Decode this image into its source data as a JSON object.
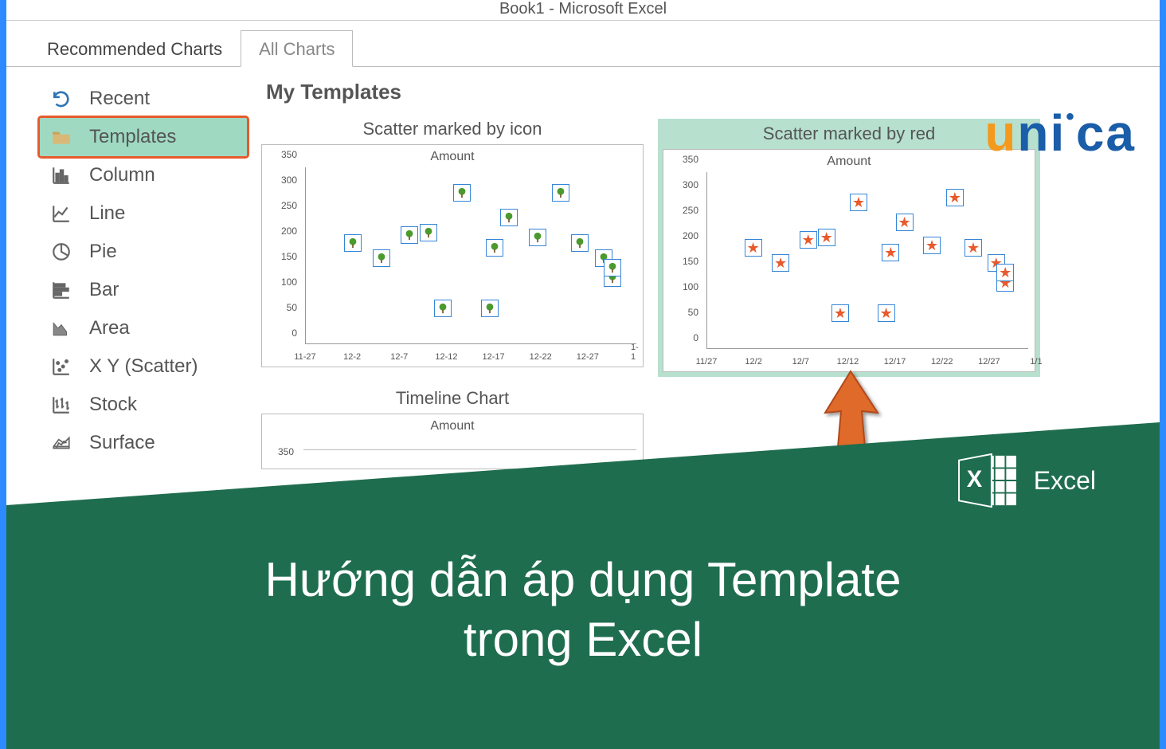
{
  "window_title": "Book1 - Microsoft Excel",
  "tabs": {
    "recommended": "Recommended Charts",
    "all": "All Charts"
  },
  "sidebar": {
    "items": [
      {
        "label": "Recent",
        "icon": "undo-icon"
      },
      {
        "label": "Templates",
        "icon": "folder-icon",
        "selected": true
      },
      {
        "label": "Column",
        "icon": "column-chart-icon"
      },
      {
        "label": "Line",
        "icon": "line-chart-icon"
      },
      {
        "label": "Pie",
        "icon": "pie-chart-icon"
      },
      {
        "label": "Bar",
        "icon": "bar-chart-icon"
      },
      {
        "label": "Area",
        "icon": "area-chart-icon"
      },
      {
        "label": "X Y (Scatter)",
        "icon": "scatter-chart-icon"
      },
      {
        "label": "Stock",
        "icon": "stock-chart-icon"
      },
      {
        "label": "Surface",
        "icon": "surface-chart-icon"
      }
    ]
  },
  "main": {
    "title": "My Templates",
    "charts": [
      {
        "title": "Scatter marked by icon",
        "inner_title": "Amount"
      },
      {
        "title": "Scatter marked by red",
        "inner_title": "Amount",
        "selected": true
      },
      {
        "title": "Timeline Chart",
        "inner_title": "Amount"
      }
    ]
  },
  "chart_data": [
    {
      "type": "scatter",
      "title": "Scatter marked by icon",
      "inner_title": "Amount",
      "xlabel": "",
      "ylabel": "",
      "ylim": [
        0,
        350
      ],
      "y_ticks": [
        0,
        50,
        100,
        150,
        200,
        250,
        300,
        350
      ],
      "x_ticks": [
        "11-27",
        "12-2",
        "12-7",
        "12-12",
        "12-17",
        "12-22",
        "12-27",
        "1-1"
      ],
      "marker": "green-tree-icon",
      "points": [
        {
          "xi": 1.0,
          "y": 200
        },
        {
          "xi": 1.6,
          "y": 170
        },
        {
          "xi": 2.2,
          "y": 215
        },
        {
          "xi": 2.6,
          "y": 220
        },
        {
          "xi": 2.9,
          "y": 70
        },
        {
          "xi": 3.3,
          "y": 300
        },
        {
          "xi": 3.9,
          "y": 70
        },
        {
          "xi": 4.0,
          "y": 190
        },
        {
          "xi": 4.3,
          "y": 250
        },
        {
          "xi": 4.9,
          "y": 210
        },
        {
          "xi": 5.4,
          "y": 300
        },
        {
          "xi": 5.8,
          "y": 200
        },
        {
          "xi": 6.3,
          "y": 170
        },
        {
          "xi": 6.5,
          "y": 130
        },
        {
          "xi": 6.5,
          "y": 150
        }
      ]
    },
    {
      "type": "scatter",
      "title": "Scatter marked by red",
      "inner_title": "Amount",
      "xlabel": "",
      "ylabel": "",
      "ylim": [
        0,
        350
      ],
      "y_ticks": [
        0,
        50,
        100,
        150,
        200,
        250,
        300,
        350
      ],
      "x_ticks": [
        "11/27",
        "12/2",
        "12/7",
        "12/12",
        "12/17",
        "12/22",
        "12/27",
        "1/1"
      ],
      "marker": "red-star",
      "points": [
        {
          "xi": 1.0,
          "y": 200
        },
        {
          "xi": 1.6,
          "y": 170
        },
        {
          "xi": 2.2,
          "y": 215
        },
        {
          "xi": 2.6,
          "y": 220
        },
        {
          "xi": 2.9,
          "y": 70
        },
        {
          "xi": 3.3,
          "y": 290
        },
        {
          "xi": 3.9,
          "y": 70
        },
        {
          "xi": 4.0,
          "y": 190
        },
        {
          "xi": 4.3,
          "y": 250
        },
        {
          "xi": 4.9,
          "y": 205
        },
        {
          "xi": 5.4,
          "y": 300
        },
        {
          "xi": 5.8,
          "y": 200
        },
        {
          "xi": 6.3,
          "y": 170
        },
        {
          "xi": 6.5,
          "y": 130
        },
        {
          "xi": 6.5,
          "y": 150
        }
      ]
    },
    {
      "type": "scatter",
      "title": "Timeline Chart",
      "inner_title": "Amount",
      "ylim": [
        0,
        350
      ],
      "y_ticks": [
        350
      ],
      "x_ticks": [],
      "points": []
    }
  ],
  "logo": {
    "brand": "unica"
  },
  "hero": {
    "headline_line1": "Hướng dẫn áp dụng Template",
    "headline_line2": "trong Excel",
    "app_label": "Excel"
  }
}
